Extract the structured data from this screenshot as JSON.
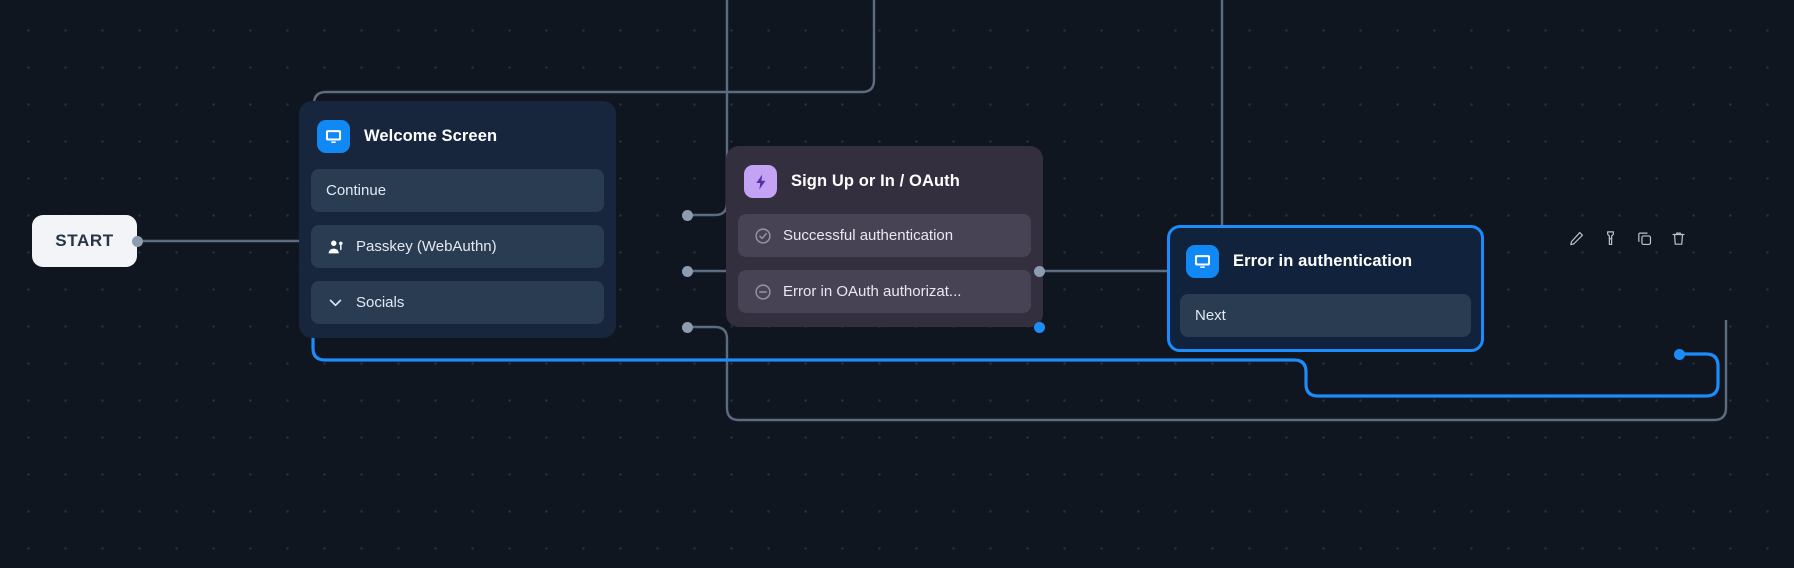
{
  "canvas": {
    "background_color": "#0f1620",
    "grid": "dot-grid"
  },
  "start_node": {
    "label": "START",
    "background_color": "#f2f4f7",
    "text_color": "#263445"
  },
  "nodes": [
    {
      "id": "welcome",
      "title": "Welcome Screen",
      "icon": "screen-icon",
      "icon_color": "#1189f5",
      "background_color": "#17263c",
      "selected": false,
      "rows": [
        {
          "label": "Continue",
          "icon": "none"
        },
        {
          "label": "Passkey (WebAuthn)",
          "icon": "user-key-icon"
        },
        {
          "label": "Socials",
          "icon": "chevron-down-icon"
        }
      ]
    },
    {
      "id": "oauth",
      "title": "Sign Up or In / OAuth",
      "icon": "lightning-bolt-icon",
      "icon_color": "#c4a3f5",
      "background_color": "#332f3e",
      "selected": false,
      "rows": [
        {
          "label": "Successful authentication",
          "icon": "check-circle-icon"
        },
        {
          "label": "Error in OAuth authorizat...",
          "icon": "minus-circle-icon"
        }
      ]
    },
    {
      "id": "error",
      "title": "Error in authentication",
      "icon": "screen-icon",
      "icon_color": "#1189f5",
      "background_color": "#11233c",
      "selected": true,
      "selection_color": "#1c8cfb",
      "rows": [
        {
          "label": "Next",
          "icon": "none"
        }
      ]
    }
  ],
  "toolbar": {
    "visible_for_node": "error",
    "buttons": [
      {
        "name": "edit",
        "icon": "pencil-icon"
      },
      {
        "name": "highlight",
        "icon": "flashlight-icon"
      },
      {
        "name": "duplicate",
        "icon": "copy-icon"
      },
      {
        "name": "delete",
        "icon": "trash-icon"
      }
    ]
  },
  "edges": {
    "default_color": "#5c6b80",
    "highlight_color": "#1c8cfb"
  }
}
